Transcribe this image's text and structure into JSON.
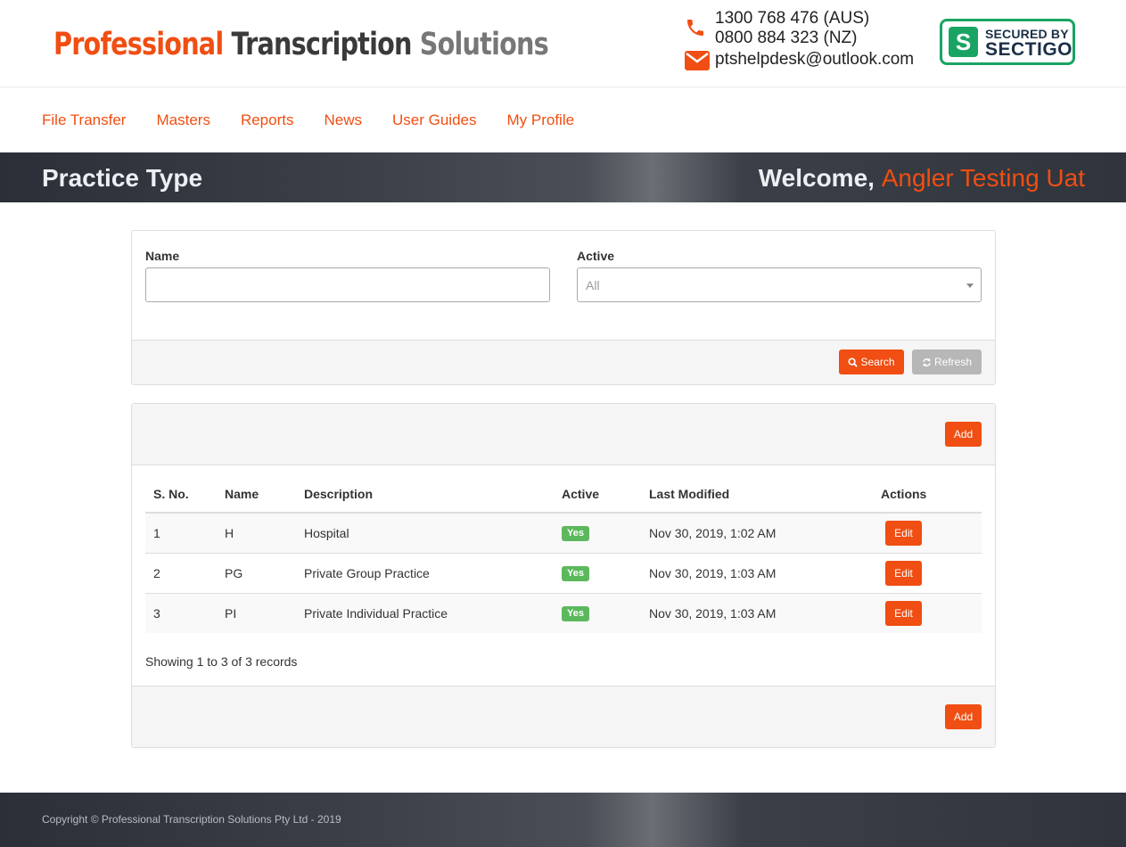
{
  "header": {
    "brand": {
      "word1": "Professional",
      "word2": "Transcription",
      "word3": "Solutions"
    },
    "contact": {
      "phone_aus": "1300 768 476 (AUS)",
      "phone_nz": "0800 884 323 (NZ)",
      "email": "ptshelpdesk@outlook.com"
    },
    "security_badge": {
      "line1": "SECURED BY",
      "line2": "SECTIGO"
    }
  },
  "nav": {
    "items": [
      "File Transfer",
      "Masters",
      "Reports",
      "News",
      "User Guides",
      "My Profile"
    ]
  },
  "page": {
    "title": "Practice Type",
    "welcome_prefix": "Welcome,",
    "user_name": "Angler Testing Uat"
  },
  "filter": {
    "name_label": "Name",
    "name_value": "",
    "active_label": "Active",
    "active_value": "All",
    "search_label": "Search",
    "refresh_label": "Refresh"
  },
  "list": {
    "add_label": "Add",
    "columns": [
      "S. No.",
      "Name",
      "Description",
      "Active",
      "Last Modified",
      "Actions"
    ],
    "rows": [
      {
        "sno": "1",
        "name": "H",
        "description": "Hospital",
        "active": "Yes",
        "modified": "Nov 30, 2019, 1:02 AM",
        "action": "Edit"
      },
      {
        "sno": "2",
        "name": "PG",
        "description": "Private Group Practice",
        "active": "Yes",
        "modified": "Nov 30, 2019, 1:03 AM",
        "action": "Edit"
      },
      {
        "sno": "3",
        "name": "PI",
        "description": "Private Individual Practice",
        "active": "Yes",
        "modified": "Nov 30, 2019, 1:03 AM",
        "action": "Edit"
      }
    ],
    "records_text": "Showing 1 to 3 of 3 records"
  },
  "footer": {
    "copyright": "Copyright © Professional Transcription Solutions Pty Ltd - 2019"
  },
  "colors": {
    "accent": "#f04e12",
    "badge_green": "#5cb85c",
    "sectigo_green": "#19a463"
  }
}
